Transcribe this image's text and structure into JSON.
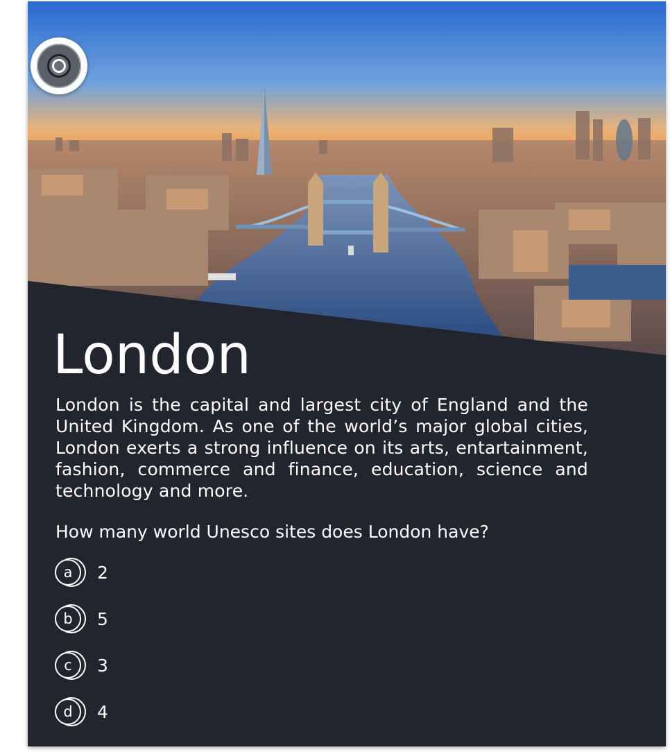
{
  "header": {
    "image_alt": "Aerial view of London with Tower Bridge and the River Thames at sunrise"
  },
  "title": "London",
  "description": "London is the capital and largest city of England and the United Kingdom. As one of the world’s major global cities, London exerts a strong influence on its arts, entartainment, fashion, commerce and finance, education,  science and technology and more.",
  "question": "How many world Unesco sites does London have?",
  "options": [
    {
      "letter": "a",
      "value": "2"
    },
    {
      "letter": "b",
      "value": "5"
    },
    {
      "letter": "c",
      "value": "3"
    },
    {
      "letter": "d",
      "value": "4"
    }
  ],
  "colors": {
    "panel": "#22252e",
    "text": "#ffffff",
    "sky_top": "#2f6fd1",
    "sky_horizon": "#f2a65a",
    "river": "#2c4f86"
  }
}
